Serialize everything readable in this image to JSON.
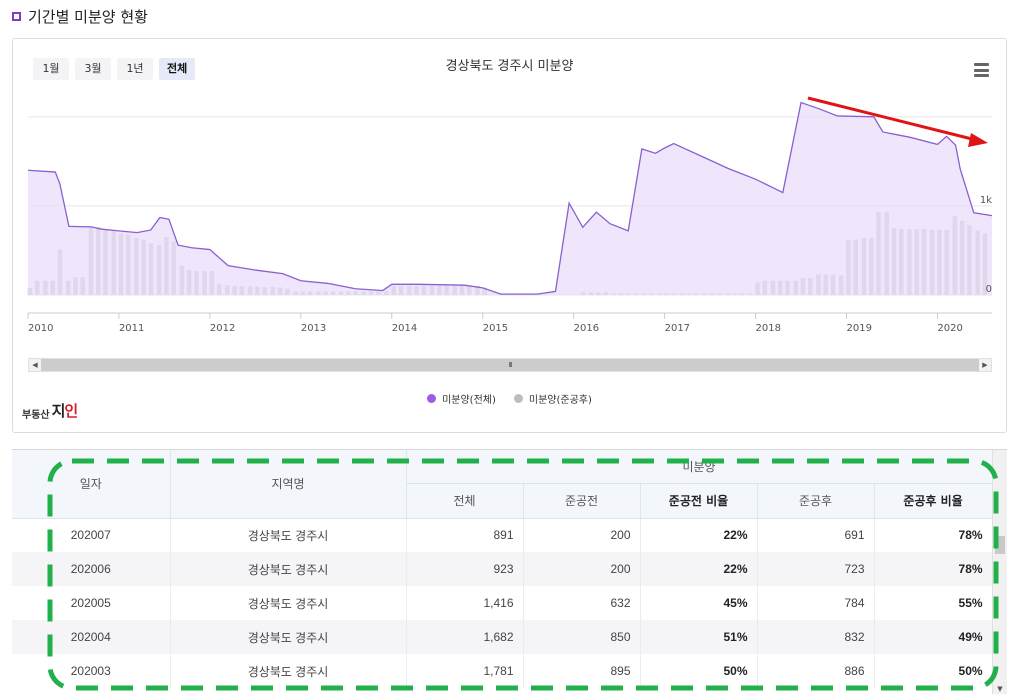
{
  "section": {
    "title": "기간별 미분양 현황"
  },
  "range_buttons": [
    "1월",
    "3월",
    "1년",
    "전체"
  ],
  "range_active_index": 3,
  "chart_title": "경상북도 경주시 미분양",
  "scroll_grip": "III",
  "legend": [
    {
      "label": "미분양(전체)",
      "color": "#9b5de5"
    },
    {
      "label": "미분양(준공후)",
      "color": "#bdbdbd"
    }
  ],
  "brand": {
    "small": "부동산",
    "big_prefix": "지",
    "big_accent": "인"
  },
  "colors": {
    "area_line": "#8a5fd0",
    "area_fill": "#e9defb",
    "bar": "#c3c3c3",
    "arrow": "#e01414",
    "dash": "#22b04b"
  },
  "chart_data": {
    "type": "area",
    "title": "경상북도 경주시 미분양",
    "x_range": [
      2010,
      2020.6
    ],
    "x_ticks": [
      "2010",
      "2011",
      "2012",
      "2013",
      "2014",
      "2015",
      "2016",
      "2017",
      "2018",
      "2019",
      "2020"
    ],
    "y_ticks": [
      {
        "value": 0,
        "label": "0"
      },
      {
        "value": 1000,
        "label": "1k"
      }
    ],
    "ylim": [
      0,
      2200
    ],
    "grid": true,
    "legend_position": "bottom",
    "series": [
      {
        "name": "미분양(전체)",
        "kind": "area",
        "points": [
          [
            2010.0,
            1400
          ],
          [
            2010.3,
            1380
          ],
          [
            2010.35,
            1250
          ],
          [
            2010.45,
            770
          ],
          [
            2010.7,
            765
          ],
          [
            2010.8,
            740
          ],
          [
            2011.0,
            720
          ],
          [
            2011.2,
            700
          ],
          [
            2011.35,
            730
          ],
          [
            2011.45,
            870
          ],
          [
            2011.55,
            850
          ],
          [
            2011.65,
            560
          ],
          [
            2011.8,
            530
          ],
          [
            2012.0,
            510
          ],
          [
            2012.2,
            330
          ],
          [
            2012.5,
            280
          ],
          [
            2012.8,
            240
          ],
          [
            2013.0,
            160
          ],
          [
            2013.3,
            130
          ],
          [
            2013.6,
            70
          ],
          [
            2013.9,
            50
          ],
          [
            2014.0,
            120
          ],
          [
            2014.3,
            120
          ],
          [
            2014.8,
            110
          ],
          [
            2015.0,
            80
          ],
          [
            2015.2,
            10
          ],
          [
            2015.6,
            10
          ],
          [
            2015.8,
            40
          ],
          [
            2015.95,
            1030
          ],
          [
            2016.1,
            760
          ],
          [
            2016.25,
            930
          ],
          [
            2016.4,
            800
          ],
          [
            2016.6,
            720
          ],
          [
            2016.75,
            1640
          ],
          [
            2016.9,
            1590
          ],
          [
            2017.0,
            1650
          ],
          [
            2017.1,
            1700
          ],
          [
            2017.4,
            1560
          ],
          [
            2017.7,
            1420
          ],
          [
            2018.0,
            1300
          ],
          [
            2018.3,
            1150
          ],
          [
            2018.5,
            2160
          ],
          [
            2018.7,
            2090
          ],
          [
            2018.9,
            2010
          ],
          [
            2019.3,
            2000
          ],
          [
            2019.4,
            1830
          ],
          [
            2019.7,
            1770
          ],
          [
            2020.0,
            1690
          ],
          [
            2020.1,
            1781
          ],
          [
            2020.2,
            1682
          ],
          [
            2020.25,
            1416
          ],
          [
            2020.4,
            923
          ],
          [
            2020.6,
            891
          ]
        ]
      },
      {
        "name": "미분양(준공후)",
        "kind": "bar",
        "bars": [
          [
            2010.0,
            80
          ],
          [
            2010.08,
            160
          ],
          [
            2010.17,
            160
          ],
          [
            2010.25,
            160
          ],
          [
            2010.33,
            510
          ],
          [
            2010.42,
            160
          ],
          [
            2010.5,
            200
          ],
          [
            2010.58,
            200
          ],
          [
            2010.67,
            760
          ],
          [
            2010.75,
            760
          ],
          [
            2010.83,
            740
          ],
          [
            2010.92,
            720
          ],
          [
            2011.0,
            690
          ],
          [
            2011.08,
            680
          ],
          [
            2011.17,
            640
          ],
          [
            2011.25,
            620
          ],
          [
            2011.33,
            580
          ],
          [
            2011.42,
            560
          ],
          [
            2011.5,
            650
          ],
          [
            2011.58,
            600
          ],
          [
            2011.67,
            330
          ],
          [
            2011.75,
            280
          ],
          [
            2011.83,
            270
          ],
          [
            2011.92,
            270
          ],
          [
            2012.0,
            270
          ],
          [
            2012.08,
            120
          ],
          [
            2012.17,
            110
          ],
          [
            2012.25,
            100
          ],
          [
            2012.33,
            100
          ],
          [
            2012.42,
            95
          ],
          [
            2012.5,
            95
          ],
          [
            2012.58,
            90
          ],
          [
            2012.67,
            90
          ],
          [
            2012.75,
            85
          ],
          [
            2012.83,
            70
          ],
          [
            2012.92,
            40
          ],
          [
            2013.0,
            40
          ],
          [
            2013.08,
            40
          ],
          [
            2013.17,
            40
          ],
          [
            2013.25,
            40
          ],
          [
            2013.33,
            40
          ],
          [
            2013.42,
            40
          ],
          [
            2013.5,
            40
          ],
          [
            2013.58,
            40
          ],
          [
            2013.67,
            40
          ],
          [
            2013.75,
            40
          ],
          [
            2013.83,
            40
          ],
          [
            2013.92,
            40
          ],
          [
            2014.0,
            100
          ],
          [
            2014.08,
            100
          ],
          [
            2014.17,
            100
          ],
          [
            2014.25,
            100
          ],
          [
            2014.33,
            100
          ],
          [
            2014.42,
            100
          ],
          [
            2014.5,
            100
          ],
          [
            2014.58,
            100
          ],
          [
            2014.67,
            100
          ],
          [
            2014.75,
            100
          ],
          [
            2014.83,
            100
          ],
          [
            2014.92,
            100
          ],
          [
            2015.0,
            80
          ],
          [
            2016.08,
            30
          ],
          [
            2016.17,
            30
          ],
          [
            2016.25,
            30
          ],
          [
            2016.33,
            30
          ],
          [
            2016.42,
            15
          ],
          [
            2016.5,
            15
          ],
          [
            2016.58,
            15
          ],
          [
            2016.67,
            15
          ],
          [
            2016.75,
            15
          ],
          [
            2016.83,
            15
          ],
          [
            2016.92,
            15
          ],
          [
            2017.0,
            15
          ],
          [
            2017.08,
            15
          ],
          [
            2017.17,
            15
          ],
          [
            2017.25,
            15
          ],
          [
            2017.33,
            15
          ],
          [
            2017.42,
            15
          ],
          [
            2017.5,
            15
          ],
          [
            2017.58,
            15
          ],
          [
            2017.67,
            15
          ],
          [
            2017.75,
            15
          ],
          [
            2017.83,
            15
          ],
          [
            2017.92,
            15
          ],
          [
            2018.0,
            140
          ],
          [
            2018.08,
            160
          ],
          [
            2018.17,
            160
          ],
          [
            2018.25,
            160
          ],
          [
            2018.33,
            160
          ],
          [
            2018.42,
            160
          ],
          [
            2018.5,
            190
          ],
          [
            2018.58,
            190
          ],
          [
            2018.67,
            230
          ],
          [
            2018.75,
            230
          ],
          [
            2018.83,
            230
          ],
          [
            2018.92,
            220
          ],
          [
            2019.0,
            620
          ],
          [
            2019.08,
            620
          ],
          [
            2019.17,
            640
          ],
          [
            2019.25,
            640
          ],
          [
            2019.33,
            930
          ],
          [
            2019.42,
            930
          ],
          [
            2019.5,
            750
          ],
          [
            2019.58,
            740
          ],
          [
            2019.67,
            740
          ],
          [
            2019.75,
            740
          ],
          [
            2019.83,
            740
          ],
          [
            2019.92,
            730
          ],
          [
            2020.0,
            730
          ],
          [
            2020.08,
            730
          ],
          [
            2020.17,
            886
          ],
          [
            2020.25,
            832
          ],
          [
            2020.33,
            784
          ],
          [
            2020.42,
            723
          ],
          [
            2020.5,
            691
          ]
        ]
      }
    ]
  },
  "table": {
    "headers": {
      "date": "일자",
      "region": "지역명",
      "group": "미분양",
      "total": "전체",
      "pre": "준공전",
      "pre_ratio": "준공전 비율",
      "post": "준공후",
      "post_ratio": "준공후 비율"
    },
    "rows": [
      {
        "date": "202007",
        "region": "경상북도 경주시",
        "total": "891",
        "pre": "200",
        "pre_ratio": "22%",
        "post": "691",
        "post_ratio": "78%"
      },
      {
        "date": "202006",
        "region": "경상북도 경주시",
        "total": "923",
        "pre": "200",
        "pre_ratio": "22%",
        "post": "723",
        "post_ratio": "78%"
      },
      {
        "date": "202005",
        "region": "경상북도 경주시",
        "total": "1,416",
        "pre": "632",
        "pre_ratio": "45%",
        "post": "784",
        "post_ratio": "55%"
      },
      {
        "date": "202004",
        "region": "경상북도 경주시",
        "total": "1,682",
        "pre": "850",
        "pre_ratio": "51%",
        "post": "832",
        "post_ratio": "49%"
      },
      {
        "date": "202003",
        "region": "경상북도 경주시",
        "total": "1,781",
        "pre": "895",
        "pre_ratio": "50%",
        "post": "886",
        "post_ratio": "50%"
      }
    ]
  }
}
